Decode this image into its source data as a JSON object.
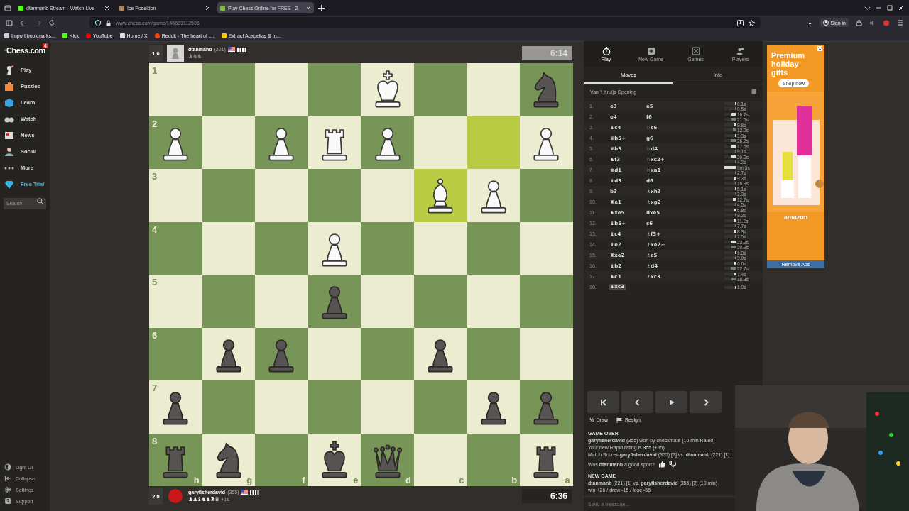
{
  "browser": {
    "tabs": [
      {
        "title": "dtanmanb Stream - Watch Live",
        "selected": false
      },
      {
        "title": "Ice Poseidon",
        "selected": false
      },
      {
        "title": "Play Chess Online for FREE - 2",
        "selected": true
      }
    ],
    "address": "www.chess.com/game/146683112506",
    "bookmarks": [
      "Import bookmarks...",
      "Kick",
      "YouTube",
      "Home / X",
      "Reddit - The heart of t...",
      "Extract Acapellas & In..."
    ],
    "sign_in": "Sign in"
  },
  "sidebar": {
    "logo": "Chess.com",
    "badge": "4",
    "items": [
      {
        "label": "Play",
        "kind": "play"
      },
      {
        "label": "Puzzles",
        "kind": "puzzles"
      },
      {
        "label": "Learn",
        "kind": "learn"
      },
      {
        "label": "Watch",
        "kind": "watch"
      },
      {
        "label": "News",
        "kind": "news"
      },
      {
        "label": "Social",
        "kind": "social"
      },
      {
        "label": "More",
        "kind": "more"
      },
      {
        "label": "Free Trial",
        "kind": "trial"
      }
    ],
    "search": {
      "placeholder": "Search"
    },
    "footer": [
      {
        "label": "Light UI",
        "kind": "theme"
      },
      {
        "label": "Collapse",
        "kind": "collapse"
      },
      {
        "label": "Settings",
        "kind": "settings"
      },
      {
        "label": "Support",
        "kind": "support"
      }
    ]
  },
  "top_player": {
    "score": "1.0",
    "name": "dtanmanb",
    "rating": "(221)",
    "captured": "♟♞♞",
    "captured_white": false,
    "clock": "6:14",
    "active": false
  },
  "board": {
    "rank_labels": [
      "1",
      "2",
      "3",
      "4",
      "5",
      "6",
      "7",
      "8"
    ],
    "file_labels": [
      "h",
      "g",
      "f",
      "e",
      "d",
      "c",
      "b",
      "a"
    ],
    "ranks": [
      [
        {
          "highlighted": false
        },
        {
          "highlighted": false
        },
        {
          "highlighted": false
        },
        {
          "highlighted": false
        },
        {
          "kind": "king",
          "white": true,
          "highlighted": false
        },
        {
          "highlighted": false
        },
        {
          "highlighted": false
        },
        {
          "kind": "knight",
          "white": false,
          "highlighted": false
        }
      ],
      [
        {
          "kind": "pawn",
          "white": true,
          "highlighted": false
        },
        {
          "highlighted": false
        },
        {
          "kind": "pawn",
          "white": true,
          "highlighted": false
        },
        {
          "kind": "rook",
          "white": true,
          "highlighted": false
        },
        {
          "kind": "pawn",
          "white": true,
          "highlighted": false
        },
        {
          "highlighted": false
        },
        {
          "highlighted": true
        },
        {
          "kind": "pawn",
          "white": true,
          "highlighted": false
        }
      ],
      [
        {
          "highlighted": false
        },
        {
          "highlighted": false
        },
        {
          "highlighted": false
        },
        {
          "highlighted": false
        },
        {
          "highlighted": false
        },
        {
          "kind": "bishop",
          "white": true,
          "highlighted": true
        },
        {
          "kind": "pawn",
          "white": true,
          "highlighted": false
        },
        {
          "highlighted": false
        }
      ],
      [
        {
          "highlighted": false
        },
        {
          "highlighted": false
        },
        {
          "highlighted": false
        },
        {
          "kind": "pawn",
          "white": true,
          "highlighted": false
        },
        {
          "highlighted": false
        },
        {
          "highlighted": false
        },
        {
          "highlighted": false
        },
        {
          "highlighted": false
        }
      ],
      [
        {
          "highlighted": false
        },
        {
          "highlighted": false
        },
        {
          "highlighted": false
        },
        {
          "kind": "pawn",
          "white": false,
          "highlighted": false
        },
        {
          "highlighted": false
        },
        {
          "highlighted": false
        },
        {
          "highlighted": false
        },
        {
          "highlighted": false
        }
      ],
      [
        {
          "highlighted": false
        },
        {
          "kind": "pawn",
          "white": false,
          "highlighted": false
        },
        {
          "kind": "pawn",
          "white": false,
          "highlighted": false
        },
        {
          "highlighted": false
        },
        {
          "highlighted": false
        },
        {
          "kind": "pawn",
          "white": false,
          "highlighted": false
        },
        {
          "highlighted": false
        },
        {
          "highlighted": false
        }
      ],
      [
        {
          "kind": "pawn",
          "white": false,
          "highlighted": false
        },
        {
          "highlighted": false
        },
        {
          "highlighted": false
        },
        {
          "highlighted": false
        },
        {
          "highlighted": false
        },
        {
          "highlighted": false
        },
        {
          "kind": "pawn",
          "white": false,
          "highlighted": false
        },
        {
          "kind": "pawn",
          "white": false,
          "highlighted": false
        }
      ],
      [
        {
          "kind": "rook",
          "white": false,
          "highlighted": false
        },
        {
          "kind": "knight",
          "white": false,
          "highlighted": false
        },
        {
          "highlighted": false
        },
        {
          "kind": "king",
          "white": false,
          "highlighted": false
        },
        {
          "kind": "queen",
          "white": false,
          "highlighted": false
        },
        {
          "highlighted": false
        },
        {
          "highlighted": false
        },
        {
          "kind": "rook",
          "white": false,
          "highlighted": false
        }
      ]
    ]
  },
  "bottom_player": {
    "score": "2.0",
    "name": "garyfisherdavid",
    "rating": "(355)",
    "captured": "♟♟♝♞♞♜♛",
    "captured_white": true,
    "advantage": "+18",
    "clock": "6:36",
    "active": true
  },
  "panel": {
    "nav": [
      {
        "label": "Play",
        "kind": "play",
        "selected": true
      },
      {
        "label": "New Game",
        "kind": "new",
        "selected": false
      },
      {
        "label": "Games",
        "kind": "games",
        "selected": false
      },
      {
        "label": "Players",
        "kind": "players",
        "selected": false
      }
    ],
    "tabs": [
      {
        "label": "Moves",
        "selected": true
      },
      {
        "label": "Info",
        "selected": false
      }
    ],
    "opening": "Van 't Kruijs Opening",
    "moves": [
      {
        "number": "1.",
        "white": {
          "san": "e3",
          "time": "0.1s",
          "level": 0.05,
          "selected": false
        },
        "black": {
          "san": "e5",
          "time": "0.5s",
          "level": 0.05,
          "selected": false
        }
      },
      {
        "number": "2.",
        "white": {
          "san": "e4",
          "time": "16.7s",
          "level": 0.35,
          "selected": false
        },
        "black": {
          "san": "f6",
          "time": "21.5s",
          "level": 0.4,
          "selected": false
        }
      },
      {
        "number": "3.",
        "white": {
          "san": "♝c4",
          "time": "9.8s",
          "level": 0.2,
          "selected": false
        },
        "black": {
          "san": "♘c6",
          "time": "12.0s",
          "level": 0.22,
          "selected": false
        }
      },
      {
        "number": "4.",
        "white": {
          "san": "♛h5+",
          "time": "3.3s",
          "level": 0.08,
          "selected": false
        },
        "black": {
          "san": "g6",
          "time": "26.2s",
          "level": 0.45,
          "selected": false
        }
      },
      {
        "number": "5.",
        "white": {
          "san": "♛h3",
          "time": "17.5s",
          "level": 0.35,
          "selected": false
        },
        "black": {
          "san": "♘d4",
          "time": "9.1s",
          "level": 0.08,
          "selected": false
        }
      },
      {
        "number": "6.",
        "white": {
          "san": "♞f3",
          "time": "20.0s",
          "level": 0.38,
          "selected": false
        },
        "black": {
          "san": "♘xc2+",
          "time": "4.2s",
          "level": 0.06,
          "selected": false
        }
      },
      {
        "number": "7.",
        "white": {
          "san": "♚d1",
          "time": "9m 5s",
          "level": 1,
          "selected": false
        },
        "black": {
          "san": "♘xa1",
          "time": "2.7s",
          "level": 0.05,
          "selected": false
        }
      },
      {
        "number": "8.",
        "white": {
          "san": "♝d3",
          "time": "9.3s",
          "level": 0.18,
          "selected": false
        },
        "black": {
          "san": "d6",
          "time": "16.9s",
          "level": 0.08,
          "selected": false
        }
      },
      {
        "number": "9.",
        "white": {
          "san": "b3",
          "time": "5.1s",
          "level": 0.08,
          "selected": false
        },
        "black": {
          "san": "♗xh3",
          "time": "2.3s",
          "level": 0.05,
          "selected": false
        }
      },
      {
        "number": "10.",
        "white": {
          "san": "♜e1",
          "time": "12.7s",
          "level": 0.25,
          "selected": false
        },
        "black": {
          "san": "♗xg2",
          "time": "4.5s",
          "level": 0.05,
          "selected": false
        }
      },
      {
        "number": "11.",
        "white": {
          "san": "♞xe5",
          "time": "5.8s",
          "level": 0.1,
          "selected": false
        },
        "black": {
          "san": "dxe5",
          "time": "9.2s",
          "level": 0.08,
          "selected": false
        }
      },
      {
        "number": "12.",
        "white": {
          "san": "♝b5+",
          "time": "11.2s",
          "level": 0.2,
          "selected": false
        },
        "black": {
          "san": "c6",
          "time": "7.7s",
          "level": 0.08,
          "selected": false
        }
      },
      {
        "number": "13.",
        "white": {
          "san": "♝c4",
          "time": "8.3s",
          "level": 0.15,
          "selected": false
        },
        "black": {
          "san": "♗f3+",
          "time": "7.5s",
          "level": 0.08,
          "selected": false
        }
      },
      {
        "number": "14.",
        "white": {
          "san": "♝e2",
          "time": "23.2s",
          "level": 0.45,
          "selected": false
        },
        "black": {
          "san": "♗xe2+",
          "time": "20.9s",
          "level": 0.4,
          "selected": false
        }
      },
      {
        "number": "15.",
        "white": {
          "san": "♜xe2",
          "time": "1.3s",
          "level": 0.05,
          "selected": false
        },
        "black": {
          "san": "♗c5",
          "time": "9.9s",
          "level": 0.08,
          "selected": false
        }
      },
      {
        "number": "16.",
        "white": {
          "san": "♝b2",
          "time": "6.6s",
          "level": 0.12,
          "selected": false
        },
        "black": {
          "san": "♗d4",
          "time": "22.7s",
          "level": 0.42,
          "selected": false
        }
      },
      {
        "number": "17.",
        "white": {
          "san": "♞c3",
          "time": "7.4s",
          "level": 0.14,
          "selected": false
        },
        "black": {
          "san": "♗xc3",
          "time": "18.3s",
          "level": 0.35,
          "selected": false
        }
      },
      {
        "number": "18.",
        "white": {
          "san": "♝xc3",
          "time": "1.9s",
          "level": 0.05,
          "selected": true
        }
      }
    ],
    "controls": [
      {
        "kind": "first"
      },
      {
        "kind": "prev"
      },
      {
        "kind": "play"
      },
      {
        "kind": "next"
      }
    ],
    "actions": [
      {
        "kind": "draw",
        "icon": "½",
        "label": "Draw"
      },
      {
        "kind": "resign",
        "label": "Resign"
      }
    ],
    "chat": [
      {
        "kind": "heading",
        "text": "GAME OVER"
      },
      {
        "kind": "line",
        "text": "**garyfisherdavid** (355) won by checkmate (10 min Rated)"
      },
      {
        "kind": "line",
        "text": "Your new Rapid rating is **355** (+35)."
      },
      {
        "kind": "line",
        "text": "Match Scores **garyfisherdavid** (355) [2] vs. **dtanmanb** (221) [1]"
      },
      {
        "kind": "rate",
        "text": "Was **dtanmanb** a good sport?"
      },
      {
        "kind": "heading",
        "text": "NEW GAME"
      },
      {
        "kind": "line",
        "text": "**dtanmanb** (221) [1] vs. **garyfisherdavid** (355) [2] (10 min)"
      },
      {
        "kind": "line",
        "text": "win +26 / draw -15 / lose -56"
      }
    ],
    "message": {
      "placeholder": "Send a message..."
    }
  },
  "ad": {
    "headline": "Premium holiday gifts",
    "button": "Shop now",
    "brand": "amazon",
    "remove": "Remove Ads"
  }
}
